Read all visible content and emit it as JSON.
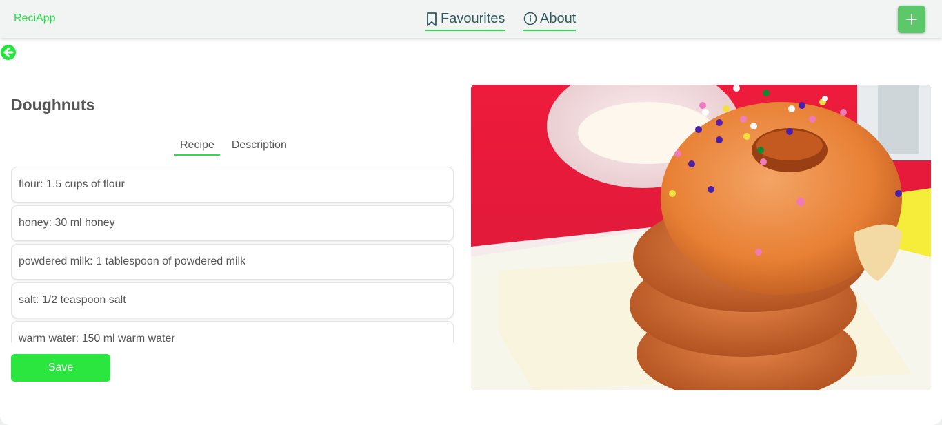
{
  "header": {
    "brand": "ReciApp",
    "nav": [
      {
        "label": "Favourites",
        "icon": "bookmark-icon"
      },
      {
        "label": "About",
        "icon": "info-icon"
      }
    ],
    "add_icon": "plus-icon",
    "accent": "#2ddc4a",
    "nav_color": "#2f5b5f"
  },
  "back_icon": "arrow-left-circle-icon",
  "recipe": {
    "title": "Doughnuts",
    "tabs": [
      {
        "label": "Recipe",
        "active": true
      },
      {
        "label": "Description",
        "active": false
      }
    ],
    "ingredients": [
      "flour: 1.5 cups of flour",
      "honey: 30 ml honey",
      "powdered milk: 1 tablespoon of powdered milk",
      "salt: 1/2 teaspoon salt",
      "warm water: 150 ml warm water"
    ],
    "save_label": "Save",
    "save_color": "#2ae63f"
  },
  "image_icon": "doughnut-photo"
}
